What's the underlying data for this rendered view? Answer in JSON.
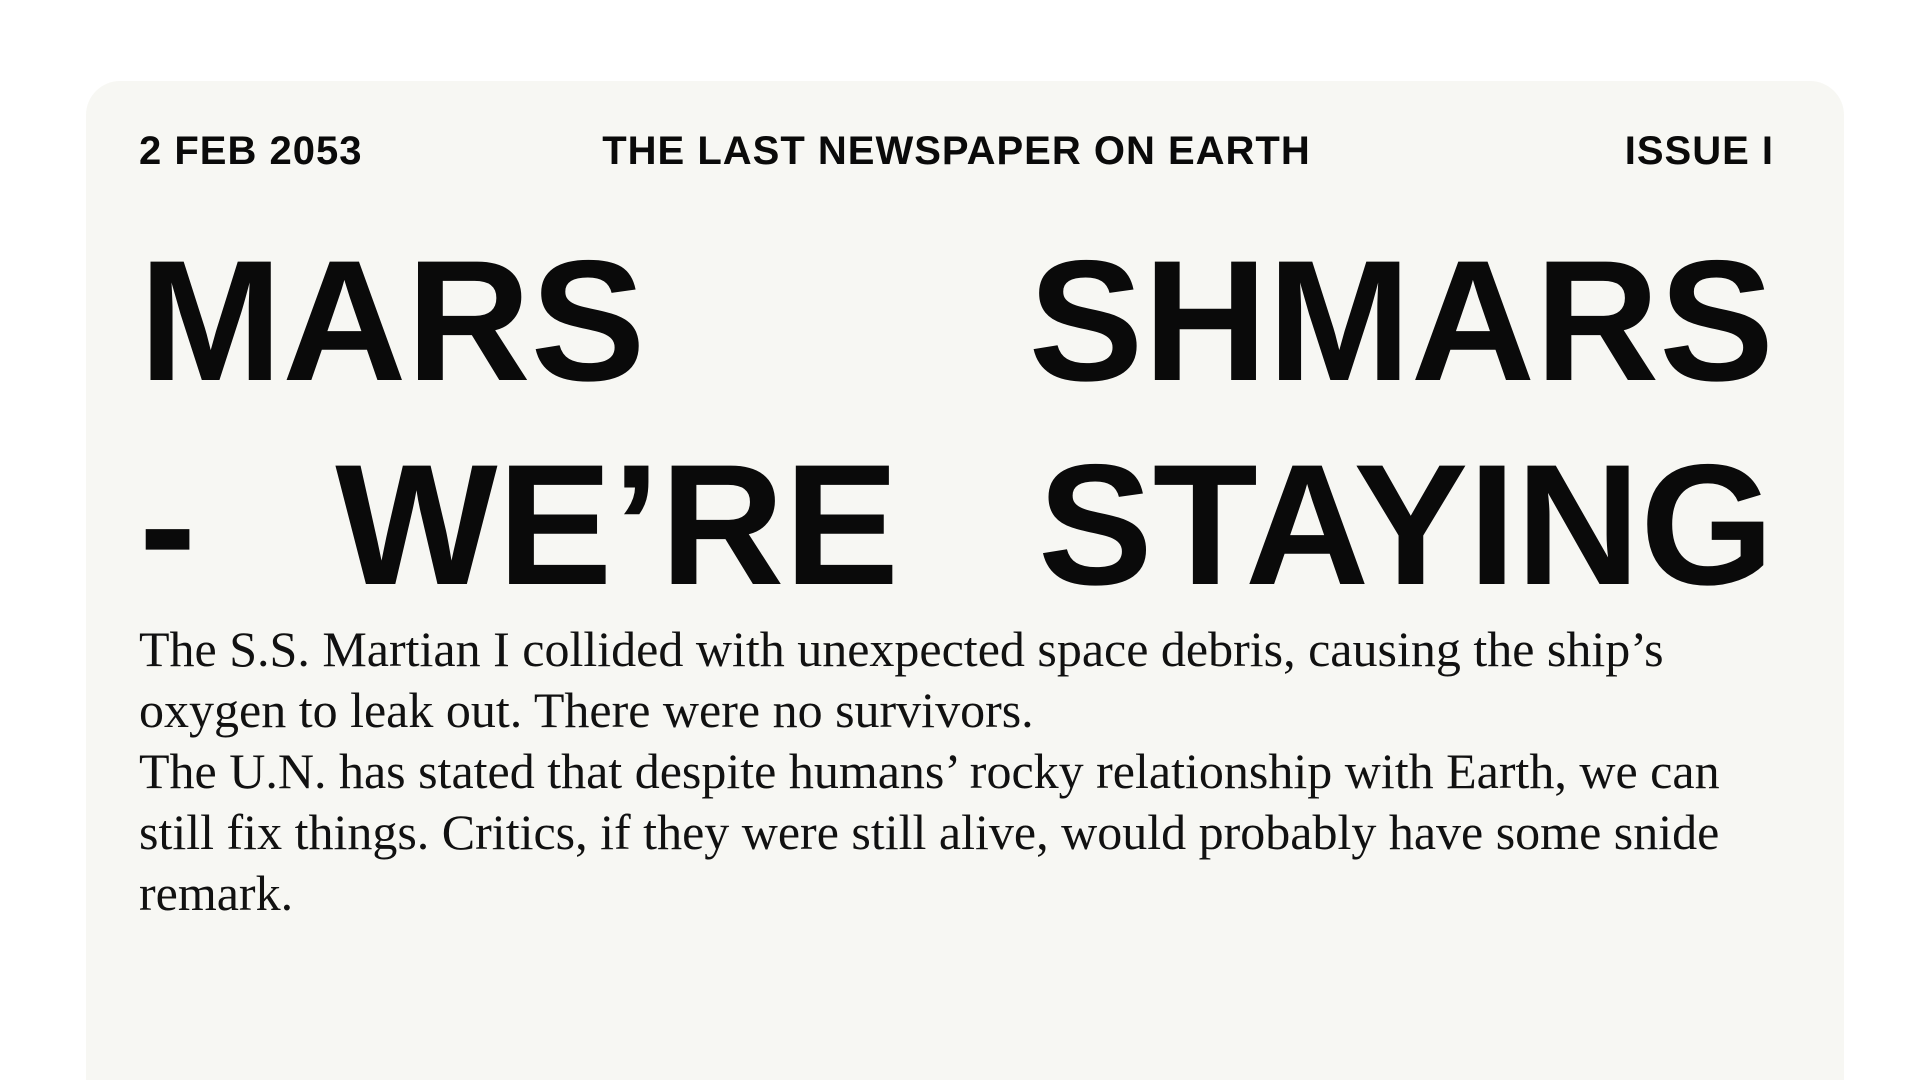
{
  "masthead": {
    "date": "2 FEB 2053",
    "title": "THE LAST NEWSPAPER ON EARTH",
    "issue": "ISSUE I"
  },
  "headline": {
    "line1": [
      "MARS",
      "SHMARS"
    ],
    "line2": [
      "-",
      "WE’RE",
      "STAYING"
    ]
  },
  "article": {
    "paragraphs": [
      "The S.S. Martian I collided with unexpected space debris, causing the ship’s oxygen to leak out. There were no survivors.",
      "The U.N. has stated that despite humans’ rocky relationship with Earth, we can still fix things. Critics, if they were still alive, would probably have some snide remark."
    ]
  },
  "colors": {
    "card_background": "#f7f7f3",
    "text": "#0a0a0a"
  }
}
